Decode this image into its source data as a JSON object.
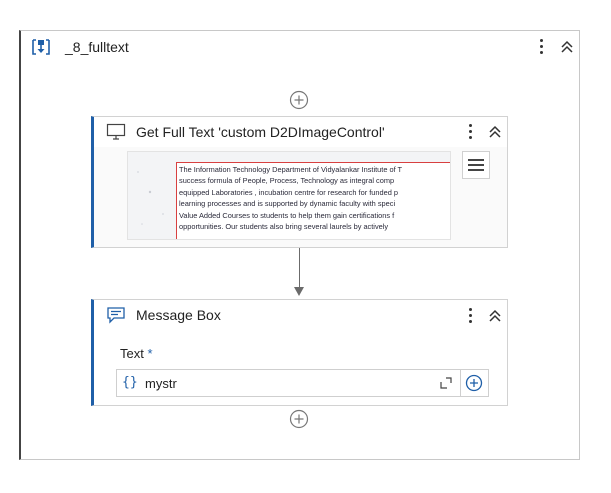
{
  "sequence": {
    "title": "_8_fulltext"
  },
  "get_full_text": {
    "title": "Get Full Text 'custom  D2DImageControl'",
    "preview_lines": [
      "The Information Technology Department of Vidyalankar Institute of T",
      "success formula of  People, Process, Technology as integral comp",
      "equipped Laboratories , incubation centre for research for funded p",
      "learning processes and is supported by dynamic faculty with speci",
      "Value Added Courses to students to help them gain certifications f",
      "opportunities. Our students also bring several laurels by actively"
    ]
  },
  "message_box": {
    "title": "Message Box",
    "field_label": "Text",
    "required_mark": "*",
    "field_prefix": "{}",
    "field_value": "mystr"
  },
  "colors": {
    "accent": "#1f5fa8",
    "preview_border": "#d84040"
  }
}
